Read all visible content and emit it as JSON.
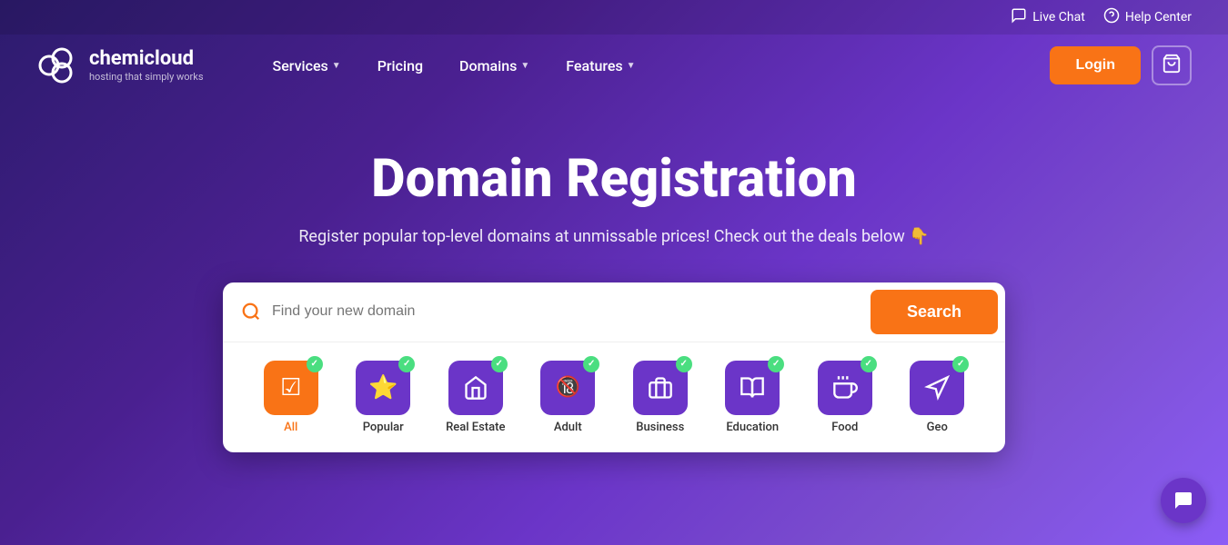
{
  "topbar": {
    "live_chat": "Live Chat",
    "help_center": "Help Center"
  },
  "header": {
    "logo_brand": "chemicloud",
    "logo_tagline": "hosting that simply works",
    "nav": [
      {
        "label": "Services",
        "has_dropdown": true
      },
      {
        "label": "Pricing",
        "has_dropdown": false
      },
      {
        "label": "Domains",
        "has_dropdown": true
      },
      {
        "label": "Features",
        "has_dropdown": true
      }
    ],
    "login_label": "Login",
    "cart_icon": "🛍"
  },
  "hero": {
    "title": "Domain Registration",
    "subtitle": "Register popular top-level domains at unmissable prices! Check out the deals below 👇"
  },
  "search": {
    "placeholder": "Find your new domain",
    "button_label": "Search"
  },
  "categories": [
    {
      "id": "all",
      "label": "All",
      "icon": "☑",
      "bg": "orange",
      "active": true
    },
    {
      "id": "popular",
      "label": "Popular",
      "icon": "⭐",
      "bg": "purple",
      "active": false
    },
    {
      "id": "real-estate",
      "label": "Real Estate",
      "icon": "🏠",
      "bg": "purple",
      "active": false
    },
    {
      "id": "adult",
      "label": "Adult",
      "icon": "🔞",
      "bg": "purple",
      "active": false
    },
    {
      "id": "business",
      "label": "Business",
      "icon": "💼",
      "bg": "purple",
      "active": false
    },
    {
      "id": "education",
      "label": "Education",
      "icon": "📖",
      "bg": "purple",
      "active": false
    },
    {
      "id": "food",
      "label": "Food",
      "icon": "🍽",
      "bg": "purple",
      "active": false
    },
    {
      "id": "geo",
      "label": "Geo",
      "icon": "📍",
      "bg": "purple",
      "active": false
    }
  ],
  "chat": {
    "icon": "💬"
  }
}
